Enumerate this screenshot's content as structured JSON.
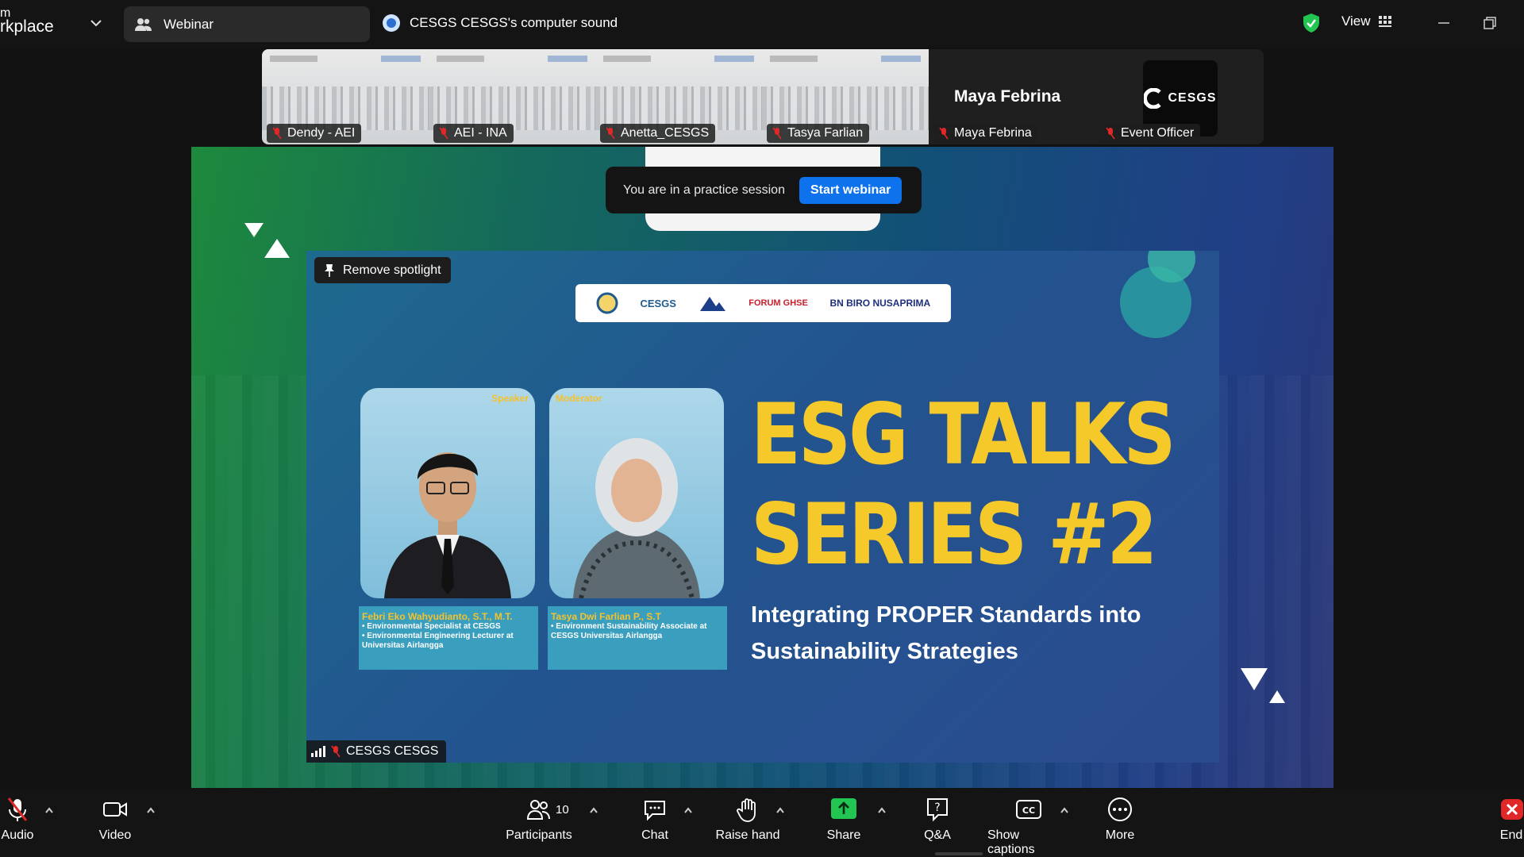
{
  "app": {
    "brand_line1": "m",
    "brand_line2": "rkplace"
  },
  "topbar": {
    "webinar_tab": "Webinar",
    "audio_source": "CESGS CESGS's computer sound",
    "view_label": "View"
  },
  "participants_strip": [
    {
      "name": "Dendy - AEI"
    },
    {
      "name": "AEI - INA"
    },
    {
      "name": "Anetta_CESGS"
    },
    {
      "name": "Tasya Farlian"
    }
  ],
  "maya_tile": {
    "display_name": "Maya Febrina",
    "label": "Maya Febrina"
  },
  "event_tile": {
    "label": "Event Officer",
    "logo_text": "CESGS"
  },
  "practice_banner": {
    "text": "You are in a practice session",
    "button": "Start webinar"
  },
  "spotlight": {
    "remove_label": "Remove spotlight",
    "speaker_label": "CESGS CESGS"
  },
  "slide": {
    "logos": [
      "CESGS",
      "FORUM GHSE",
      "BN BIRO NUSAPRIMA"
    ],
    "speaker_role": "Speaker",
    "moderator_role": "Moderator",
    "speaker_name": "Febri Eko Wahyudianto, S.T., M.T.",
    "speaker_bullets": [
      "Environmental Specialist at CESGS",
      "Environmental Engineering Lecturer at Universitas Airlangga"
    ],
    "moderator_name": "Tasya Dwi Farlian P., S.T",
    "moderator_desc": "Environment Sustainability Associate at CESGS Universitas Airlangga",
    "title_line1": "ESG TALKS",
    "title_line2": "SERIES #2",
    "subtitle": "Integrating PROPER Standards into Sustainability Strategies"
  },
  "toolbar": {
    "audio": "Audio",
    "video": "Video",
    "participants": "Participants",
    "participants_count": "10",
    "chat": "Chat",
    "raise_hand": "Raise hand",
    "share": "Share",
    "qa": "Q&A",
    "captions": "Show captions",
    "more": "More",
    "end": "End"
  },
  "colors": {
    "accent_blue": "#0e72ed",
    "share_green": "#23c552",
    "end_red": "#e02828",
    "title_yellow": "#f6c92a"
  }
}
